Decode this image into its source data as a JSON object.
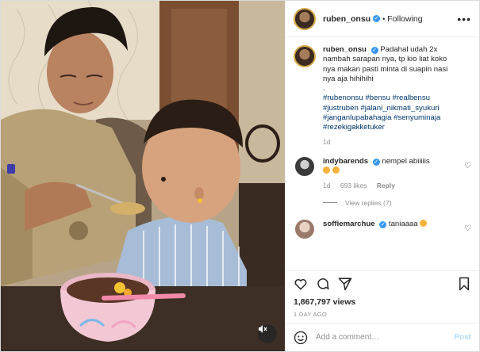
{
  "post": {
    "username": "ruben_onsu",
    "verified_mark": "✓",
    "separator": "•",
    "follow_status": "Following",
    "more_label": "•••"
  },
  "caption": {
    "username": "ruben_onsu",
    "text": "Padahal udah 2x nambah sarapan nya, tp kio liat koko nya makan pasti minta di suapin nasi nya aja hihihihi",
    "dot": ".",
    "hashtags": "#rubenonsu #bensu #realbensu #justruben #jalani_nikmati_syukuri #janganlupabahagia #senyuminaja #rezekigakketuker",
    "age": "1d"
  },
  "comments": [
    {
      "username": "indybarends",
      "text": "nempel abiiiiis",
      "age": "1d",
      "likes": "693 likes",
      "reply_label": "Reply",
      "view_replies": "View replies (7)",
      "emoji_colors": [
        "#f7b23b",
        "#f7b23b"
      ]
    },
    {
      "username": "soffiemarchue",
      "text": "taniaaaa",
      "emoji_colors": [
        "#f7b23b"
      ]
    }
  ],
  "stats": {
    "views": "1,867,797 views",
    "date": "1 DAY AGO"
  },
  "composer": {
    "placeholder": "Add a comment…",
    "post_label": "Post"
  },
  "icons": {
    "like": "heart-icon",
    "comment": "comment-icon",
    "share": "share-icon",
    "save": "bookmark-icon",
    "mute": "speaker-muted-icon",
    "emoji": "smiley-icon"
  },
  "colors": {
    "hashtag": "#00376b",
    "verified": "#3897f0",
    "muted_text": "#8e8e8e",
    "post_disabled": "#b2dffc"
  }
}
